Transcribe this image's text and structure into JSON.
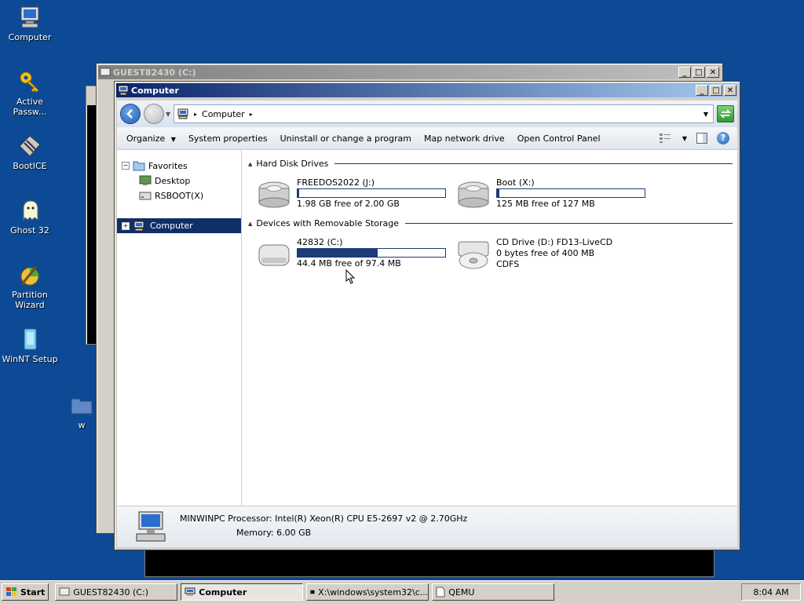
{
  "desktop": {
    "icons": [
      {
        "label": "Computer"
      },
      {
        "label": "Active Passw..."
      },
      {
        "label": "BootICE"
      },
      {
        "label": "Ghost 32"
      },
      {
        "label": "Partition Wizard"
      },
      {
        "label": "WinNT Setup"
      }
    ],
    "partial_folder_label": "w"
  },
  "background_window": {
    "title": "GUEST82430 (C:)"
  },
  "explorer": {
    "title": "Computer",
    "breadcrumb": "Computer",
    "toolbar": {
      "organize": "Organize",
      "system_properties": "System properties",
      "uninstall": "Uninstall or change a program",
      "map_drive": "Map network drive",
      "control_panel": "Open Control Panel"
    },
    "nav": {
      "favorites": "Favorites",
      "desktop": "Desktop",
      "rsboot": "RSBOOT(X)",
      "computer": "Computer"
    },
    "groups": {
      "hard_disk": "Hard Disk Drives",
      "removable": "Devices with Removable Storage"
    },
    "hard_drives": [
      {
        "name": "FREEDOS2022 (J:)",
        "free": "1.98 GB free of 2.00 GB",
        "used_fraction": 0.01
      },
      {
        "name": "Boot (X:)",
        "free": "125 MB free of 127 MB",
        "used_fraction": 0.016
      }
    ],
    "removable": [
      {
        "name": "42832 (C:)",
        "free": "44.4 MB free of 97.4 MB",
        "used_fraction": 0.544
      },
      {
        "name": "CD Drive (D:) FD13-LiveCD",
        "free": "0 bytes free of 400 MB",
        "fs": "CDFS"
      }
    ],
    "details": {
      "computer_name": "MINWINPC",
      "processor_label": "Processor:",
      "processor": "Intel(R) Xeon(R) CPU E5-2697 v2 @ 2.70GHz",
      "memory_label": "Memory:",
      "memory": "6.00 GB"
    }
  },
  "taskbar": {
    "start": "Start",
    "items": [
      {
        "label": "GUEST82430 (C:)"
      },
      {
        "label": "Computer"
      },
      {
        "label": "X:\\windows\\system32\\c..."
      },
      {
        "label": "QEMU"
      }
    ],
    "clock": "8:04 AM"
  }
}
